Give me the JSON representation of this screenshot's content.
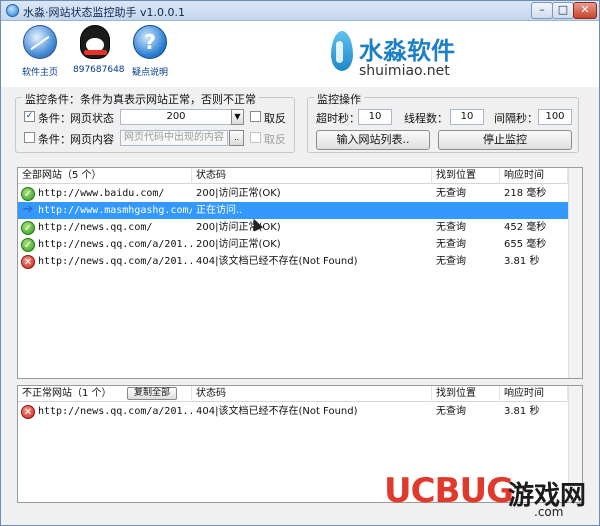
{
  "window": {
    "title": "水淼·网站状态监控助手 v1.0.0.1",
    "controls": {
      "minimize": "–",
      "maximize": "□",
      "close": "✕"
    }
  },
  "toolbar": {
    "items": [
      {
        "label": "软件主页",
        "icon": "globe-icon"
      },
      {
        "label": "897687648",
        "icon": "qq-penguin-icon"
      },
      {
        "label": "疑点说明",
        "icon": "help-icon"
      }
    ]
  },
  "logo": {
    "cn": "水淼软件",
    "en": "shuimiao.net"
  },
  "conditions": {
    "title": "监控条件：条件为真表示网站正常，否则不正常",
    "row1": {
      "checked": true,
      "label": "条件：",
      "field": "网页状态",
      "value": "200",
      "invert_label": "取反"
    },
    "row2": {
      "checked": false,
      "label": "条件：",
      "field": "网页内容",
      "placeholder": "网页代码中出现的内容",
      "browse": "..",
      "invert_label": "取反"
    }
  },
  "operations": {
    "title": "监控操作",
    "timeout_label": "超时秒：",
    "timeout_value": "10",
    "threads_label": "线程数：",
    "threads_value": "10",
    "interval_label": "间隔秒：",
    "interval_value": "100",
    "import_button": "输入网站列表..",
    "stop_button": "停止监控"
  },
  "all_sites": {
    "header": "全部网站（5 个）",
    "columns": [
      "状态码",
      "找到位置",
      "响应时间"
    ],
    "rows": [
      {
        "status": "ok",
        "url": "http://www.baidu.com/",
        "code": "200|访问正常(OK)",
        "found": "无查询",
        "time": "218 毫秒"
      },
      {
        "status": "running",
        "url": "http://www.masmhgashg.com/",
        "code": "正在访问..",
        "found": "",
        "time": ""
      },
      {
        "status": "ok",
        "url": "http://news.qq.com/",
        "code": "200|访问正常(OK)",
        "found": "无查询",
        "time": "452 毫秒"
      },
      {
        "status": "ok",
        "url": "http://news.qq.com/a/201...",
        "code": "200|访问正常(OK)",
        "found": "无查询",
        "time": "655 毫秒"
      },
      {
        "status": "error",
        "url": "http://news.qq.com/a/201...",
        "code": "404|该文档已经不存在(Not Found)",
        "found": "无查询",
        "time": "3.81 秒"
      }
    ]
  },
  "abnormal_sites": {
    "header": "不正常网站（1 个）",
    "copy_button": "复制全部",
    "columns": [
      "状态码",
      "找到位置",
      "响应时间"
    ],
    "rows": [
      {
        "status": "error",
        "url": "http://news.qq.com/a/201...",
        "code": "404|该文档已经不存在(Not Found)",
        "found": "无查询",
        "time": "3.81 秒"
      }
    ]
  },
  "watermark": {
    "brand": "UCBUG",
    "game": "游戏网",
    "domain": ".com"
  }
}
